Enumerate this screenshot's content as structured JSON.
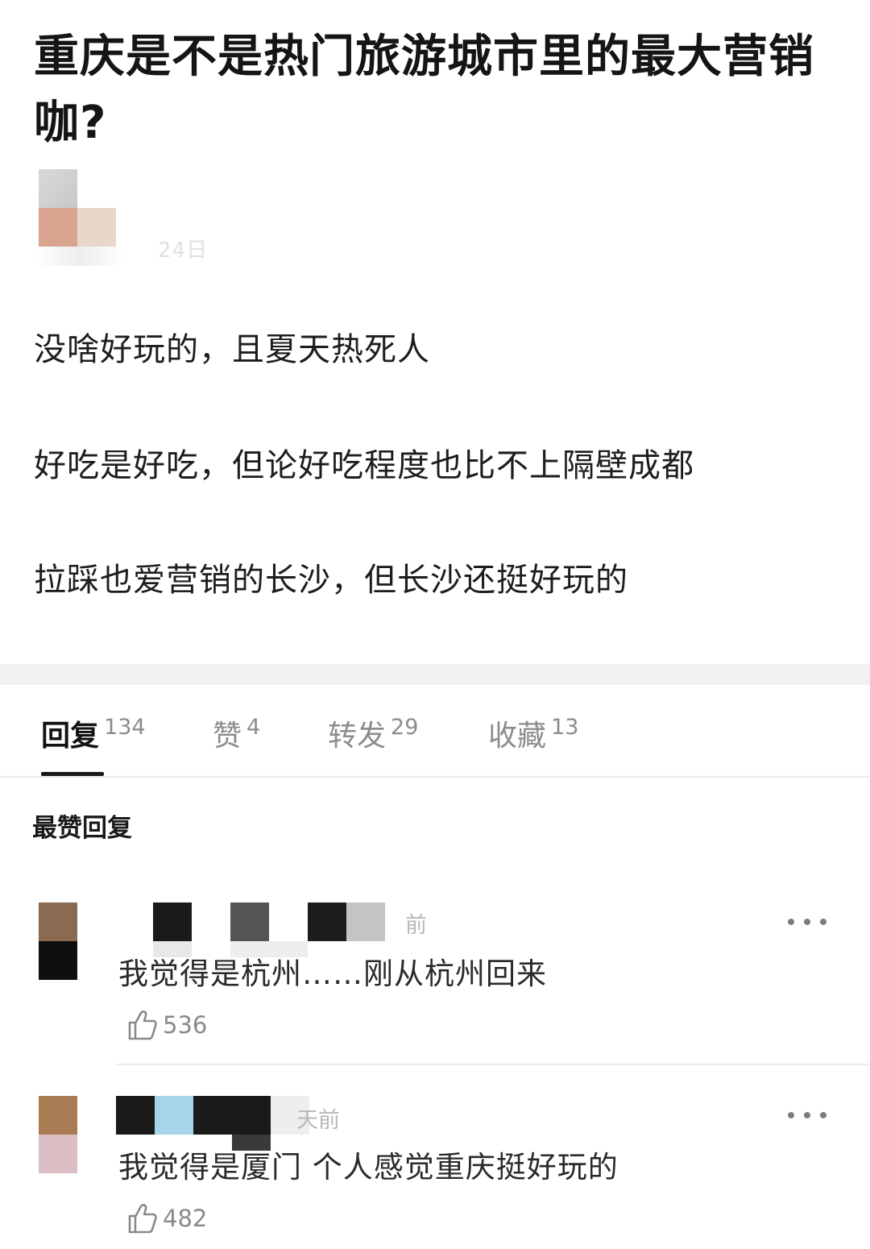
{
  "post": {
    "title": "重庆是不是热门旅游城市里的最大营销咖?",
    "date": "24日",
    "paragraphs": [
      "没啥好玩的，且夏天热死人",
      "好吃是好吃，但论好吃程度也比不上隔壁成都",
      "拉踩也爱营销的长沙，但长沙还挺好玩的"
    ]
  },
  "tabs": [
    {
      "label": "回复",
      "count": "134"
    },
    {
      "label": "赞",
      "count": "4"
    },
    {
      "label": "转发",
      "count": "29"
    },
    {
      "label": "收藏",
      "count": "13"
    }
  ],
  "section_heading": "最赞回复",
  "replies": [
    {
      "time": "前",
      "text": "我觉得是杭州……刚从杭州回来",
      "likes": "536"
    },
    {
      "time": "天前",
      "text": "我觉得是厦门 个人感觉重庆挺好玩的",
      "likes": "482"
    }
  ],
  "icons": {
    "like": "thumbs-up-icon",
    "more": "more-dots-icon"
  },
  "colors": {
    "text": "#1a1a1a",
    "muted": "#8c8c8c",
    "divider": "#f1f1f1"
  }
}
